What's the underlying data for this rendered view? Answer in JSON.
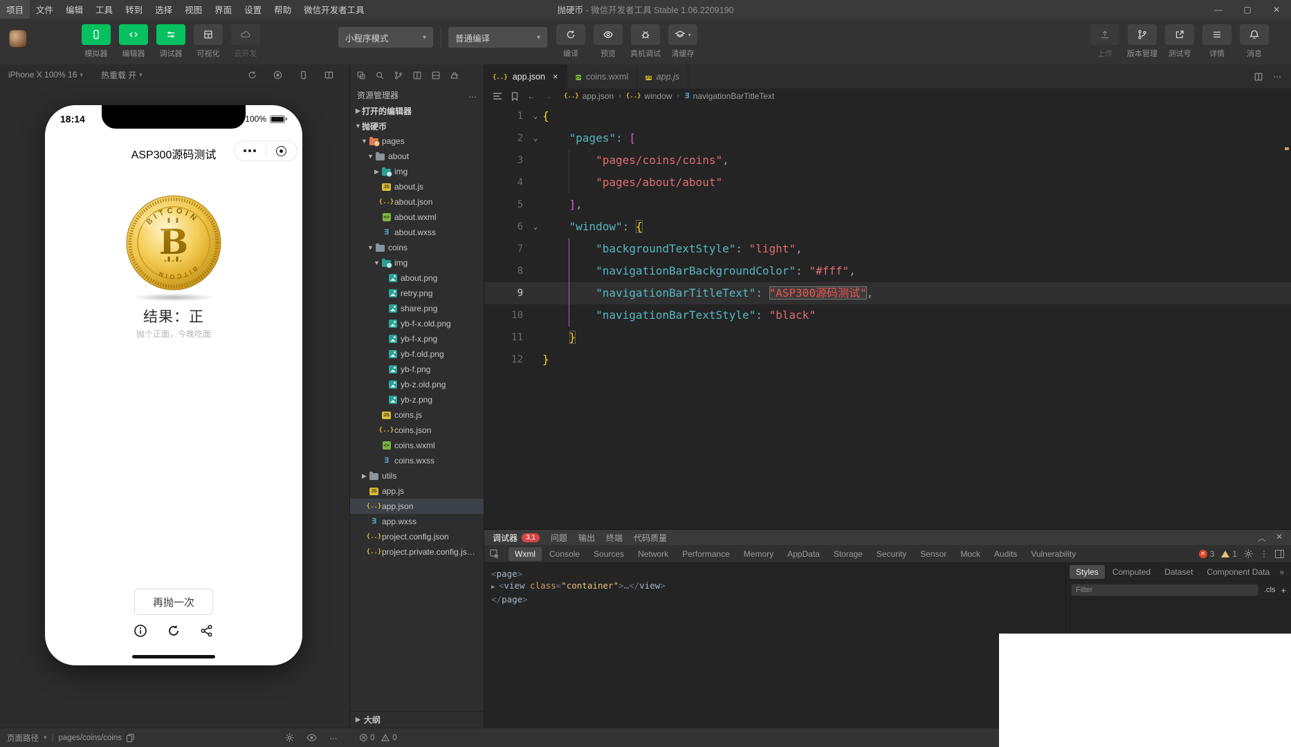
{
  "titlebar": {
    "menus": [
      "项目",
      "文件",
      "编辑",
      "工具",
      "转到",
      "选择",
      "视图",
      "界面",
      "设置",
      "帮助",
      "微信开发者工具"
    ],
    "title_project": "抛硬币",
    "title_rest": " - 微信开发者工具 Stable 1.06.2209190",
    "window_controls": [
      "minimize",
      "maximize",
      "close"
    ]
  },
  "toolbar": {
    "left_buttons": [
      {
        "label": "模拟器",
        "icon": "phone",
        "style": "green"
      },
      {
        "label": "编辑器",
        "icon": "code",
        "style": "green"
      },
      {
        "label": "调试器",
        "icon": "sliders",
        "style": "green"
      },
      {
        "label": "可视化",
        "icon": "grid",
        "style": "gray"
      },
      {
        "label": "云开发",
        "icon": "cloud",
        "style": "disabled"
      }
    ],
    "mode_select": "小程序模式",
    "compile_select": "普通编译",
    "action_buttons": [
      {
        "label": "编译",
        "icon": "refresh"
      },
      {
        "label": "预览",
        "icon": "eye"
      },
      {
        "label": "真机调试",
        "icon": "bug"
      },
      {
        "label": "清缓存",
        "icon": "layers",
        "dropdown": true
      }
    ],
    "right_buttons": [
      {
        "label": "上传",
        "icon": "upload",
        "disabled": true
      },
      {
        "label": "版本管理",
        "icon": "branch"
      },
      {
        "label": "测试号",
        "icon": "external"
      },
      {
        "label": "详情",
        "icon": "menu"
      },
      {
        "label": "消息",
        "icon": "bell"
      }
    ]
  },
  "simulator": {
    "device_label": "iPhone X 100% 16",
    "hot_reload_label": "热重载 开",
    "bar_icons": [
      "rotate",
      "record",
      "device",
      "expand"
    ],
    "phone": {
      "time": "18:14",
      "battery": "100%",
      "nav_title": "ASP300源码测试",
      "coin_brand": "BITCOIN",
      "coin_symbol": "B",
      "coin_stars": "*****",
      "result_text": "结果：正",
      "result_sub": "抛个正面，今晚吃面",
      "retry_label": "再抛一次",
      "action_icons": [
        "info",
        "reload",
        "share"
      ]
    }
  },
  "sidebar": {
    "title": "资源管理器",
    "more_label": "…",
    "toolbar_icons": [
      "new-window",
      "search",
      "git",
      "split",
      "panel",
      "kettle"
    ],
    "tree": [
      {
        "label": "打开的编辑器",
        "indent": 0,
        "arrow": "right",
        "section": true
      },
      {
        "label": "抛硬币",
        "indent": 0,
        "arrow": "down",
        "section": true
      },
      {
        "label": "pages",
        "icon": "folder-pages",
        "indent": 1,
        "arrow": "down"
      },
      {
        "label": "about",
        "icon": "folder",
        "indent": 2,
        "arrow": "down"
      },
      {
        "label": "img",
        "icon": "folder-img",
        "indent": 3,
        "arrow": "right"
      },
      {
        "label": "about.js",
        "icon": "js",
        "indent": 3
      },
      {
        "label": "about.json",
        "icon": "json",
        "indent": 3
      },
      {
        "label": "about.wxml",
        "icon": "wxml",
        "indent": 3
      },
      {
        "label": "about.wxss",
        "icon": "wxss",
        "indent": 3
      },
      {
        "label": "coins",
        "icon": "folder",
        "indent": 2,
        "arrow": "down"
      },
      {
        "label": "img",
        "icon": "folder-img",
        "indent": 3,
        "arrow": "down"
      },
      {
        "label": "about.png",
        "icon": "png",
        "indent": 4
      },
      {
        "label": "retry.png",
        "icon": "png",
        "indent": 4
      },
      {
        "label": "share.png",
        "icon": "png",
        "indent": 4
      },
      {
        "label": "yb-f-x.old.png",
        "icon": "png",
        "indent": 4
      },
      {
        "label": "yb-f-x.png",
        "icon": "png",
        "indent": 4
      },
      {
        "label": "yb-f.old.png",
        "icon": "png",
        "indent": 4
      },
      {
        "label": "yb-f.png",
        "icon": "png",
        "indent": 4
      },
      {
        "label": "yb-z.old.png",
        "icon": "png",
        "indent": 4
      },
      {
        "label": "yb-z.png",
        "icon": "png",
        "indent": 4
      },
      {
        "label": "coins.js",
        "icon": "js",
        "indent": 3
      },
      {
        "label": "coins.json",
        "icon": "json",
        "indent": 3
      },
      {
        "label": "coins.wxml",
        "icon": "wxml",
        "indent": 3
      },
      {
        "label": "coins.wxss",
        "icon": "wxss",
        "indent": 3
      },
      {
        "label": "utils",
        "icon": "folder",
        "indent": 1,
        "arrow": "right"
      },
      {
        "label": "app.js",
        "icon": "js",
        "indent": 1
      },
      {
        "label": "app.json",
        "icon": "json",
        "indent": 1,
        "selected": true
      },
      {
        "label": "app.wxss",
        "icon": "wxss",
        "indent": 1
      },
      {
        "label": "project.config.json",
        "icon": "json",
        "indent": 1
      },
      {
        "label": "project.private.config.js…",
        "icon": "json",
        "indent": 1
      }
    ],
    "outline_label": "大纲"
  },
  "editor": {
    "tabs": [
      {
        "label": "app.json",
        "icon": "json",
        "active": true,
        "close": "×"
      },
      {
        "label": "coins.wxml",
        "icon": "wxml"
      },
      {
        "label": "app.js",
        "icon": "js",
        "preview": true
      }
    ],
    "breadcrumb": [
      {
        "label": "app.json",
        "icon": "json"
      },
      {
        "label": "window",
        "icon": "braces"
      },
      {
        "label": "navigationBarTitleText",
        "icon": "field"
      }
    ],
    "code_lines": [
      {
        "n": 1,
        "fold": true,
        "t": [
          [
            "{",
            "b1"
          ]
        ]
      },
      {
        "n": 2,
        "fold": true,
        "t": [
          [
            "    ",
            ""
          ],
          [
            "\"pages\"",
            "key"
          ],
          [
            ": ",
            "pun"
          ],
          [
            "[",
            "b2"
          ]
        ]
      },
      {
        "n": 3,
        "g": "gray",
        "t": [
          [
            "        ",
            ""
          ],
          [
            "\"pages/coins/coins\"",
            "str"
          ],
          [
            ",",
            "pun"
          ]
        ]
      },
      {
        "n": 4,
        "g": "gray",
        "t": [
          [
            "        ",
            ""
          ],
          [
            "\"pages/about/about\"",
            "str"
          ]
        ]
      },
      {
        "n": 5,
        "t": [
          [
            "    ",
            ""
          ],
          [
            "]",
            "b2"
          ],
          [
            ",",
            "pun"
          ]
        ]
      },
      {
        "n": 6,
        "fold": true,
        "t": [
          [
            "    ",
            ""
          ],
          [
            "\"window\"",
            "key"
          ],
          [
            ": ",
            "pun"
          ],
          [
            "{",
            "b1 boxed"
          ]
        ]
      },
      {
        "n": 7,
        "g": "active",
        "t": [
          [
            "        ",
            ""
          ],
          [
            "\"backgroundTextStyle\"",
            "key"
          ],
          [
            ": ",
            "pun"
          ],
          [
            "\"light\"",
            "str"
          ],
          [
            ",",
            "pun"
          ]
        ]
      },
      {
        "n": 8,
        "g": "active",
        "t": [
          [
            "        ",
            ""
          ],
          [
            "\"navigationBarBackgroundColor\"",
            "key"
          ],
          [
            ": ",
            "pun"
          ],
          [
            "\"#fff\"",
            "str"
          ],
          [
            ",",
            "pun"
          ]
        ]
      },
      {
        "n": 9,
        "current": true,
        "g": "active",
        "t": [
          [
            "        ",
            ""
          ],
          [
            "\"navigationBarTitleText\"",
            "key"
          ],
          [
            ": ",
            "pun"
          ],
          [
            "\"ASP300源码测试\"",
            "str sel"
          ],
          [
            ",",
            "pun"
          ]
        ]
      },
      {
        "n": 10,
        "g": "active",
        "t": [
          [
            "        ",
            ""
          ],
          [
            "\"navigationBarTextStyle\"",
            "key"
          ],
          [
            ": ",
            "pun"
          ],
          [
            "\"black\"",
            "str"
          ]
        ]
      },
      {
        "n": 11,
        "t": [
          [
            "    ",
            ""
          ],
          [
            "}",
            "b1 boxed"
          ]
        ]
      },
      {
        "n": 12,
        "t": [
          [
            "}",
            "b1"
          ]
        ]
      }
    ]
  },
  "debugger": {
    "panel_tabs": [
      {
        "label": "调试器",
        "active": true,
        "badge": "3,1"
      },
      {
        "label": "问题"
      },
      {
        "label": "输出"
      },
      {
        "label": "终端"
      },
      {
        "label": "代码质量"
      }
    ],
    "devtools_tabs": [
      "Wxml",
      "Console",
      "Sources",
      "Network",
      "Performance",
      "Memory",
      "AppData",
      "Storage",
      "Security",
      "Sensor",
      "Mock",
      "Audits",
      "Vulnerability"
    ],
    "active_devtools_tab": "Wxml",
    "error_count": "3",
    "warning_count": "1",
    "wxml_lines": [
      [
        [
          "<",
          "pun"
        ],
        [
          "page",
          "tag"
        ],
        [
          ">",
          "pun"
        ]
      ],
      [
        [
          "▶ ",
          "arrow"
        ],
        [
          "<",
          "pun"
        ],
        [
          "view",
          "tag"
        ],
        [
          " ",
          ""
        ],
        [
          "class",
          "attr"
        ],
        [
          "=",
          "pun"
        ],
        [
          "\"container\"",
          "val"
        ],
        [
          ">",
          "pun"
        ],
        [
          "…",
          "dim"
        ],
        [
          "</",
          "pun"
        ],
        [
          "view",
          "tag"
        ],
        [
          ">",
          "pun"
        ]
      ],
      [
        [
          "</",
          "pun"
        ],
        [
          "page",
          "tag"
        ],
        [
          ">",
          "pun"
        ]
      ]
    ],
    "styles_tabs": [
      "Styles",
      "Computed",
      "Dataset",
      "Component Data"
    ],
    "styles_active_tab": "Styles",
    "filter_placeholder": "Filter",
    "cls_label": ".cls",
    "plus_label": "+"
  },
  "statusbar": {
    "page_path_label": "页面路径",
    "page_path": "pages/coins/coins",
    "error_count": "0",
    "warning_count": "0"
  },
  "colors": {
    "accent_green": "#07c160",
    "titlebar_bg": "#3a3a3a",
    "toolbar_bg": "#333333",
    "panel_bg": "#2c2c2c",
    "sidebar_bg": "#2e2e2e",
    "editor_bg": "#242424",
    "tabbar_bg": "#2d2d2d",
    "statusbar_bg": "#333333",
    "key": "#56b6c2",
    "string": "#e06c75",
    "brace": "#ffd70b",
    "bracket": "#d65fd6",
    "error_red": "#e1452c",
    "warn_yellow": "#e5c07b",
    "selected_row": "#3d4148",
    "badge_red": "#d64541"
  }
}
